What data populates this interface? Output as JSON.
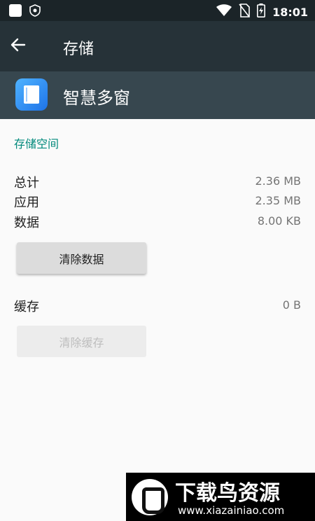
{
  "status_bar": {
    "time": "18:01",
    "icons": [
      "square-icon",
      "shield-icon",
      "wifi-icon",
      "no-sim-icon",
      "battery-charging-icon"
    ]
  },
  "app_bar": {
    "title": "存储",
    "back_icon": "arrow-left-icon"
  },
  "app_header": {
    "name": "智慧多窗",
    "icon": "app-icon"
  },
  "storage": {
    "section_title": "存储空间",
    "rows": [
      {
        "label": "总计",
        "value": "2.36 MB"
      },
      {
        "label": "应用",
        "value": "2.35 MB"
      },
      {
        "label": "数据",
        "value": "8.00 KB"
      }
    ],
    "clear_data_label": "清除数据"
  },
  "cache": {
    "label": "缓存",
    "value": "0 B",
    "clear_cache_label": "清除缓存"
  },
  "watermark": {
    "title": "下载鸟资源",
    "url": "www.xiazainiao.com"
  },
  "colors": {
    "status_bar": "#1b2428",
    "app_bar": "#263238",
    "app_header": "#37474f",
    "accent": "#00897b",
    "background": "#fafafa"
  }
}
